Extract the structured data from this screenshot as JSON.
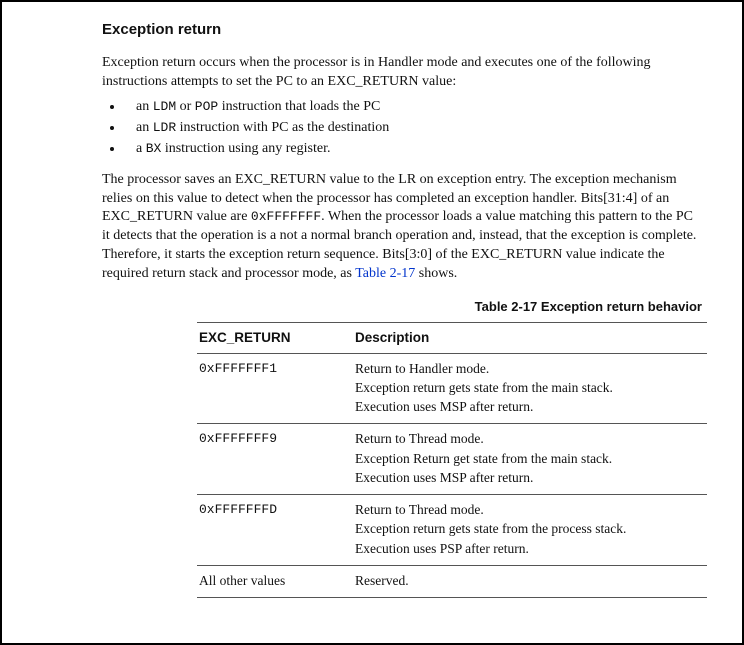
{
  "section": {
    "title": "Exception return",
    "intro": "Exception return occurs when the processor is in Handler mode and executes one of the following instructions attempts to set the PC to an EXC_RETURN value:",
    "bullets": [
      {
        "prefix": "an ",
        "code": "LDM",
        "mid": " or ",
        "code2": "POP",
        "suffix": " instruction that loads the PC"
      },
      {
        "prefix": "an ",
        "code": "LDR",
        "mid": "",
        "code2": "",
        "suffix": " instruction with PC as the destination"
      },
      {
        "prefix": "a ",
        "code": "BX",
        "mid": "",
        "code2": "",
        "suffix": " instruction using any register."
      }
    ],
    "body_pre": "The processor saves an EXC_RETURN value to the LR on exception entry. The exception mechanism relies on this value to detect when the processor has completed an exception handler. Bits[31:4] of an EXC_RETURN value are ",
    "body_code": "0xFFFFFFF",
    "body_post": ". When the processor loads a value matching this pattern to the PC it detects that the operation is a not a normal branch operation and, instead, that the exception is complete. Therefore, it starts the exception return sequence. Bits[3:0] of the EXC_RETURN value indicate the required return stack and processor mode, as ",
    "body_link": "Table 2-17",
    "body_tail": " shows."
  },
  "table": {
    "caption": "Table 2-17 Exception return behavior",
    "headers": {
      "col1": "EXC_RETURN",
      "col2": "Description"
    },
    "rows": [
      {
        "code": "0xFFFFFFF1",
        "lines": [
          "Return to Handler mode.",
          "Exception return gets state from the main stack.",
          "Execution uses MSP after return."
        ]
      },
      {
        "code": "0xFFFFFFF9",
        "lines": [
          "Return to Thread mode.",
          "Exception Return get state from the main stack.",
          "Execution uses MSP after return."
        ]
      },
      {
        "code": "0xFFFFFFFD",
        "lines": [
          "Return to Thread mode.",
          "Exception return gets state from the process stack.",
          "Execution uses PSP after return."
        ]
      },
      {
        "code": "All other values",
        "code_is_plain": true,
        "lines": [
          "Reserved."
        ]
      }
    ]
  }
}
